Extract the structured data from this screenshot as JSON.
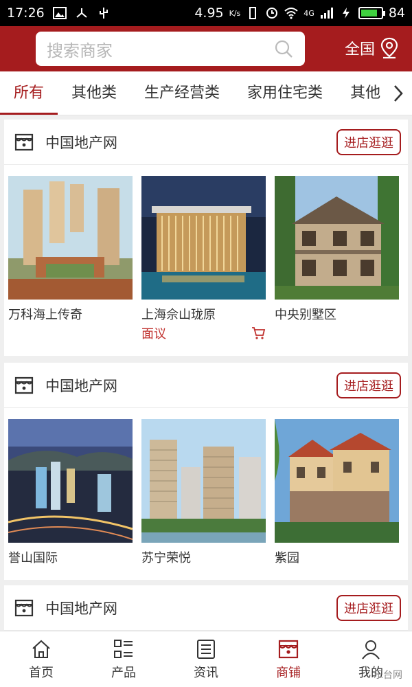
{
  "status_bar": {
    "time": "17:26",
    "net_speed": "4.95",
    "net_unit": "K/s",
    "network": "4G",
    "battery": "84",
    "battery_fraction": 0.84
  },
  "header": {
    "search_placeholder": "搜索商家",
    "region_label": "全国",
    "colors": {
      "brand": "#a51c1e"
    }
  },
  "tabs": [
    {
      "label": "所有",
      "active": true
    },
    {
      "label": "其他类"
    },
    {
      "label": "生产经营类"
    },
    {
      "label": "家用住宅类"
    },
    {
      "label": "其他"
    }
  ],
  "stores": [
    {
      "name": "中国地产网",
      "visit_label": "进店逛逛",
      "items": [
        {
          "name": "万科海上传奇",
          "price": ""
        },
        {
          "name": "上海佘山珑原",
          "price": "面议"
        },
        {
          "name": "中央别墅区",
          "price": ""
        }
      ]
    },
    {
      "name": "中国地产网",
      "visit_label": "进店逛逛",
      "items": [
        {
          "name": "誉山国际",
          "price": ""
        },
        {
          "name": "苏宁荣悦",
          "price": ""
        },
        {
          "name": "紫园",
          "price": ""
        }
      ]
    },
    {
      "name": "中国地产网",
      "visit_label": "进店逛逛",
      "items": []
    }
  ],
  "bottom_nav": [
    {
      "label": "首页",
      "icon": "home-icon"
    },
    {
      "label": "产品",
      "icon": "grid-list-icon"
    },
    {
      "label": "资讯",
      "icon": "news-icon"
    },
    {
      "label": "商铺",
      "icon": "store-icon",
      "active": true
    },
    {
      "label": "我的",
      "icon": "user-icon"
    }
  ],
  "watermark": "乐台网"
}
